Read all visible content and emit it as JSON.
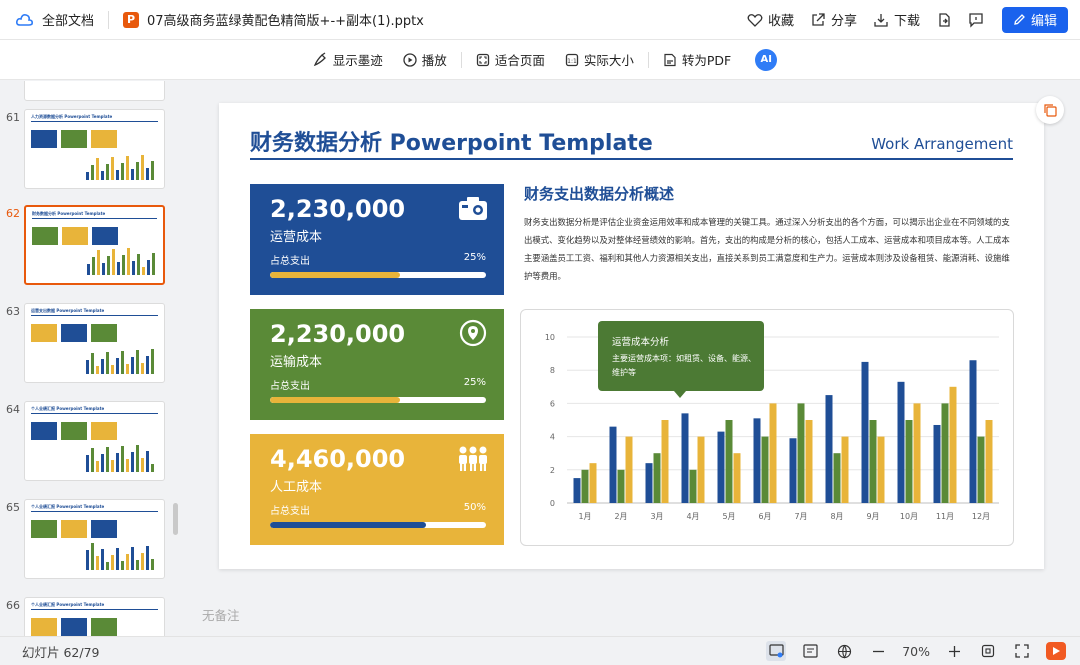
{
  "topbar": {
    "all_docs": "全部文档",
    "file_name": "07高级商务蓝绿黄配色精简版+-+副本(1).pptx",
    "favorite": "收藏",
    "share": "分享",
    "download": "下载",
    "edit": "编辑"
  },
  "toolbar": {
    "ink": "显示墨迹",
    "play": "播放",
    "fit_page": "适合页面",
    "actual_size": "实际大小",
    "to_pdf": "转为PDF",
    "ai": "AI"
  },
  "sidebar": {
    "items": [
      {
        "num": "61",
        "title": "人力资源数据分析 Powerpoint Template",
        "active": false
      },
      {
        "num": "62",
        "title": "财务数据分析 Powerpoint Template",
        "active": true
      },
      {
        "num": "63",
        "title": "运营支出数据 Powerpoint Template",
        "active": false
      },
      {
        "num": "64",
        "title": "个人业绩汇报 Powerpoint Template",
        "active": false
      },
      {
        "num": "65",
        "title": "个人业绩汇报 Powerpoint Template",
        "active": false
      },
      {
        "num": "66",
        "title": "个人业绩汇报 Powerpoint Template",
        "active": false
      }
    ]
  },
  "slide": {
    "title": "财务数据分析 Powerpoint Template",
    "subtitle": "Work Arrangement",
    "cards": [
      {
        "value": "2,230,000",
        "label": "运营成本",
        "share_label": "占总支出",
        "percent": "25%",
        "fill": 0.6,
        "bg": "#1f4e96",
        "fill_color": "#e8b43a",
        "icon": "camera-icon"
      },
      {
        "value": "2,230,000",
        "label": "运输成本",
        "share_label": "占总支出",
        "percent": "25%",
        "fill": 0.6,
        "bg": "#5a8a37",
        "fill_color": "#e8b43a",
        "icon": "location-icon"
      },
      {
        "value": "4,460,000",
        "label": "人工成本",
        "share_label": "占总支出",
        "percent": "50%",
        "fill": 0.72,
        "bg": "#e8b43a",
        "fill_color": "#1f4e96",
        "icon": "people-icon"
      }
    ],
    "overview_heading": "财务支出数据分析概述",
    "overview_body": "财务支出数据分析是评估企业资金运用效率和成本管理的关键工具。通过深入分析支出的各个方面，可以揭示出企业在不同领域的支出模式、变化趋势以及对整体经营绩效的影响。首先，支出的构成是分析的核心，包括人工成本、运营成本和项目成本等。人工成本主要涵盖员工工资、福利和其他人力资源相关支出，直接关系到员工满意度和生产力。运营成本则涉及设备租赁、能源消耗、设施维护等费用。",
    "tooltip": {
      "title": "运营成本分析",
      "body": "主要运营成本项：如租赁、设备、能源、维护等"
    }
  },
  "chart_data": {
    "type": "bar",
    "categories": [
      "1月",
      "2月",
      "3月",
      "4月",
      "5月",
      "6月",
      "7月",
      "8月",
      "9月",
      "10月",
      "11月",
      "12月"
    ],
    "series": [
      {
        "values": [
          1.5,
          4.6,
          2.4,
          5.4,
          4.3,
          5.1,
          3.9,
          6.5,
          8.5,
          7.3,
          4.7,
          8.6
        ],
        "color": "#1f4e96"
      },
      {
        "values": [
          2.0,
          2.0,
          3.0,
          2.0,
          5.0,
          4.0,
          6.0,
          3.0,
          5.0,
          5.0,
          6.0,
          4.0
        ],
        "color": "#5a8a37"
      },
      {
        "values": [
          2.4,
          4.0,
          5.0,
          4.0,
          3.0,
          6.0,
          5.0,
          4.0,
          4.0,
          6.0,
          7.0,
          5.0
        ],
        "color": "#e8b43a"
      }
    ],
    "y_ticks": [
      "0",
      "2",
      "4",
      "6",
      "8",
      "10"
    ],
    "ylim": [
      0,
      10
    ],
    "grid": true
  },
  "notes": "无备注",
  "status": {
    "slide_count": "幻灯片 62/79",
    "zoom": "70%"
  }
}
